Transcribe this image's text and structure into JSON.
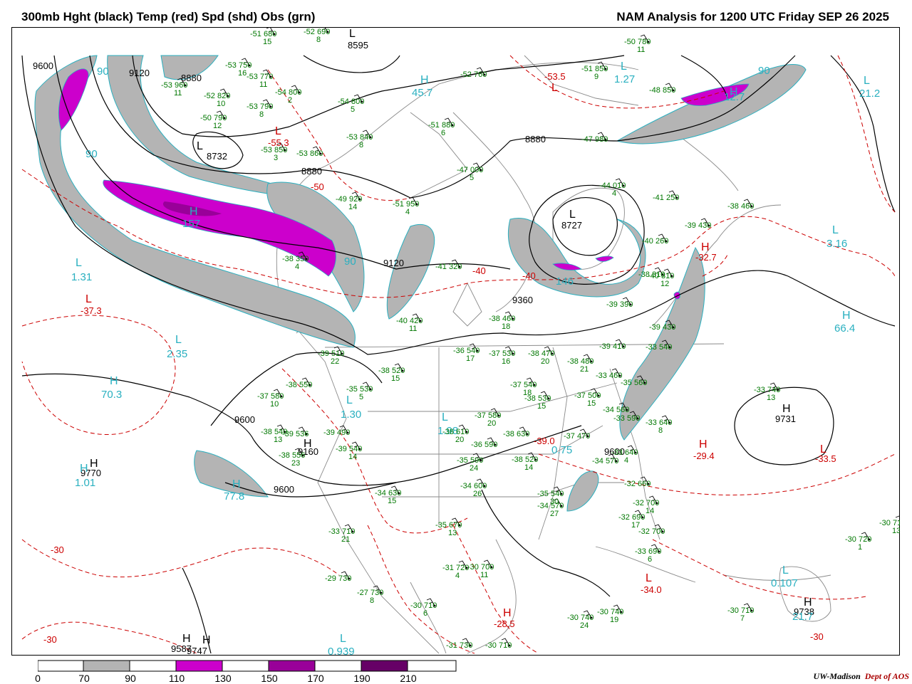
{
  "header": {
    "left_title": "300mb Hght (black) Temp (red) Spd (shd) Obs (grn)",
    "right_title": "NAM Analysis for 1200 UTC Friday  SEP 26 2025"
  },
  "colors": {
    "height": "#000000",
    "temp": "#cc0000",
    "speed_label": "#2ab0c0",
    "obs": "#007700",
    "shade_70_90": "#b4b4b4",
    "shade_110_130": "#cc00cc",
    "shade_150_170": "#990099",
    "shade_190_210": "#660066",
    "map_border": "#888888"
  },
  "height_labels": [
    "9600",
    "9120",
    "8880",
    "8732",
    "8595",
    "8880",
    "8880",
    "9120",
    "8727",
    "9360",
    "9600",
    "9600",
    "9600",
    "9731",
    "9738",
    "9587",
    "9747",
    "9770",
    "9160"
  ],
  "temp_labels": [
    "-53.5",
    "-55.3",
    "-50",
    "-37.3",
    "-40",
    "-40",
    "-32.7",
    "-39.0",
    "-29.4",
    "-33.5",
    "-30",
    "-34.0",
    "-28.5",
    "-30",
    "-30"
  ],
  "speed_labels": [
    "90",
    "90",
    "157",
    "90",
    "146",
    "1.31",
    "2.35",
    "70.3",
    "1.30",
    "1.01",
    "77.8",
    "3.16",
    "66.4",
    "21.2",
    "1.27",
    "45.7",
    "90",
    "12.7",
    "1.98",
    "0.75",
    "0.939",
    "0.107",
    "21.7"
  ],
  "obs": [
    {
      "t": "-51",
      "h": "680",
      "s": "15"
    },
    {
      "t": "-52",
      "h": "690",
      "s": "8"
    },
    {
      "t": "-53",
      "h": "750",
      "s": "16"
    },
    {
      "t": "-53",
      "h": "770",
      "s": "11"
    },
    {
      "t": "-53",
      "h": "960",
      "s": "11"
    },
    {
      "t": "-52",
      "h": "820",
      "s": "10"
    },
    {
      "t": "-54",
      "h": "800",
      "s": "2"
    },
    {
      "t": "-53",
      "h": "790",
      "s": "8"
    },
    {
      "t": "-54",
      "h": "800",
      "s": "5"
    },
    {
      "t": "-50",
      "h": "790",
      "s": "12"
    },
    {
      "t": "-53",
      "h": "850",
      "s": "3"
    },
    {
      "t": "-53",
      "h": "860",
      "s": ""
    },
    {
      "t": "-53",
      "h": "840",
      "s": "8"
    },
    {
      "t": "-51",
      "h": "880",
      "s": "6"
    },
    {
      "t": "-52",
      "h": "760",
      "s": ""
    },
    {
      "t": "-51",
      "h": "850",
      "s": "9"
    },
    {
      "t": "-50",
      "h": "780",
      "s": "11"
    },
    {
      "t": "-48",
      "h": "850",
      "s": ""
    },
    {
      "t": "-47",
      "h": "980",
      "s": ""
    },
    {
      "t": "-47",
      "h": "000",
      "s": "5"
    },
    {
      "t": "-44",
      "h": "010",
      "s": "4"
    },
    {
      "t": "-41",
      "h": "250",
      "s": ""
    },
    {
      "t": "-38",
      "h": "460",
      "s": ""
    },
    {
      "t": "-39",
      "h": "430",
      "s": ""
    },
    {
      "t": "-49",
      "h": "920",
      "s": "14"
    },
    {
      "t": "-51",
      "h": "950",
      "s": "4"
    },
    {
      "t": "-41",
      "h": "320",
      "s": ""
    },
    {
      "t": "-38",
      "h": "350",
      "s": "4"
    },
    {
      "t": "-40",
      "h": "420",
      "s": "11"
    },
    {
      "t": "-38",
      "h": "460",
      "s": "18"
    },
    {
      "t": "-39",
      "h": "510",
      "s": "22"
    },
    {
      "t": "-38",
      "h": "520",
      "s": "15"
    },
    {
      "t": "-36",
      "h": "540",
      "s": "17"
    },
    {
      "t": "-37",
      "h": "530",
      "s": "16"
    },
    {
      "t": "-38",
      "h": "470",
      "s": "20"
    },
    {
      "t": "-38",
      "h": "480",
      "s": "21"
    },
    {
      "t": "-39",
      "h": "410",
      "s": ""
    },
    {
      "t": "-38",
      "h": "550",
      "s": ""
    },
    {
      "t": "-37",
      "h": "580",
      "s": "10"
    },
    {
      "t": "-35",
      "h": "530",
      "s": "5"
    },
    {
      "t": "-37",
      "h": "540",
      "s": "18"
    },
    {
      "t": "-38",
      "h": "530",
      "s": "15"
    },
    {
      "t": "-37",
      "h": "500",
      "s": "15"
    },
    {
      "t": "-33",
      "h": "460",
      "s": ""
    },
    {
      "t": "-35",
      "h": "560",
      "s": ""
    },
    {
      "t": "-38",
      "h": "540",
      "s": "13"
    },
    {
      "t": "-39",
      "h": "540",
      "s": "14"
    },
    {
      "t": "-37",
      "h": "580",
      "s": "20"
    },
    {
      "t": "-38",
      "h": "610",
      "s": "20"
    },
    {
      "t": "-36",
      "h": "590",
      "s": ""
    },
    {
      "t": "-38",
      "h": "630",
      "s": ""
    },
    {
      "t": "-37",
      "h": "470",
      "s": ""
    },
    {
      "t": "-35",
      "h": "590",
      "s": "24"
    },
    {
      "t": "-38",
      "h": "520",
      "s": "14"
    },
    {
      "t": "-34",
      "h": "570",
      "s": ""
    },
    {
      "t": "-34",
      "h": "560",
      "s": ""
    },
    {
      "t": "-33",
      "h": "590",
      "s": ""
    },
    {
      "t": "-33",
      "h": "640",
      "s": "8"
    },
    {
      "t": "-33",
      "h": "640",
      "s": "4"
    },
    {
      "t": "-34",
      "h": "630",
      "s": "15"
    },
    {
      "t": "-34",
      "h": "600",
      "s": "26"
    },
    {
      "t": "-35",
      "h": "540",
      "s": "30"
    },
    {
      "t": "-34",
      "h": "570",
      "s": "27"
    },
    {
      "t": "-32",
      "h": "660",
      "s": ""
    },
    {
      "t": "-32",
      "h": "700",
      "s": "14"
    },
    {
      "t": "-32",
      "h": "690",
      "s": "17"
    },
    {
      "t": "-32",
      "h": "700",
      "s": ""
    },
    {
      "t": "-33",
      "h": "690",
      "s": "6"
    },
    {
      "t": "-33",
      "h": "710",
      "s": "21"
    },
    {
      "t": "-35",
      "h": "670",
      "s": "13"
    },
    {
      "t": "-31",
      "h": "720",
      "s": "4"
    },
    {
      "t": "-30",
      "h": "700",
      "s": "11"
    },
    {
      "t": "-29",
      "h": "730",
      "s": ""
    },
    {
      "t": "-27",
      "h": "730",
      "s": "8"
    },
    {
      "t": "-30",
      "h": "710",
      "s": "6"
    },
    {
      "t": "-30",
      "h": "740",
      "s": "24"
    },
    {
      "t": "-30",
      "h": "740",
      "s": "19"
    },
    {
      "t": "-30",
      "h": "710",
      "s": "7"
    },
    {
      "t": "-30",
      "h": "720",
      "s": "1"
    },
    {
      "t": "-30",
      "h": "710",
      "s": "13"
    },
    {
      "t": "-31",
      "h": "730",
      "s": ""
    },
    {
      "t": "-30",
      "h": "710",
      "s": ""
    },
    {
      "t": "-33",
      "h": "740",
      "s": "13"
    },
    {
      "t": "-38",
      "h": "310",
      "s": ""
    },
    {
      "t": "-40",
      "h": "260",
      "s": ""
    },
    {
      "t": "-39",
      "h": "390",
      "s": ""
    },
    {
      "t": "-40",
      "h": "310",
      "s": "12"
    },
    {
      "t": "-39",
      "h": "430",
      "s": ""
    },
    {
      "t": "-33",
      "h": "540",
      "s": ""
    },
    {
      "t": "-38",
      "h": "556",
      "s": "23"
    },
    {
      "t": "-39",
      "h": "536",
      "s": ""
    },
    {
      "t": "-39",
      "h": "490",
      "s": ""
    }
  ],
  "legend": {
    "ticks": [
      "0",
      "70",
      "90",
      "110",
      "130",
      "150",
      "170",
      "190",
      "210"
    ]
  },
  "credit": {
    "org": "UW-Madison",
    "dept": "Dept of AOS"
  }
}
